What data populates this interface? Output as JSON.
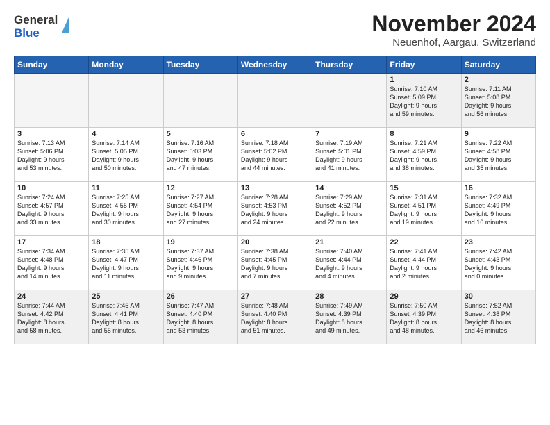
{
  "logo": {
    "line1": "General",
    "line2": "Blue"
  },
  "header": {
    "month": "November 2024",
    "location": "Neuenhof, Aargau, Switzerland"
  },
  "weekdays": [
    "Sunday",
    "Monday",
    "Tuesday",
    "Wednesday",
    "Thursday",
    "Friday",
    "Saturday"
  ],
  "weeks": [
    [
      {
        "day": "",
        "info": ""
      },
      {
        "day": "",
        "info": ""
      },
      {
        "day": "",
        "info": ""
      },
      {
        "day": "",
        "info": ""
      },
      {
        "day": "",
        "info": ""
      },
      {
        "day": "1",
        "info": "Sunrise: 7:10 AM\nSunset: 5:09 PM\nDaylight: 9 hours and 59 minutes."
      },
      {
        "day": "2",
        "info": "Sunrise: 7:11 AM\nSunset: 5:08 PM\nDaylight: 9 hours and 56 minutes."
      }
    ],
    [
      {
        "day": "3",
        "info": "Sunrise: 7:13 AM\nSunset: 5:06 PM\nDaylight: 9 hours and 53 minutes."
      },
      {
        "day": "4",
        "info": "Sunrise: 7:14 AM\nSunset: 5:05 PM\nDaylight: 9 hours and 50 minutes."
      },
      {
        "day": "5",
        "info": "Sunrise: 7:16 AM\nSunset: 5:03 PM\nDaylight: 9 hours and 47 minutes."
      },
      {
        "day": "6",
        "info": "Sunrise: 7:18 AM\nSunset: 5:02 PM\nDaylight: 9 hours and 44 minutes."
      },
      {
        "day": "7",
        "info": "Sunrise: 7:19 AM\nSunset: 5:01 PM\nDaylight: 9 hours and 41 minutes."
      },
      {
        "day": "8",
        "info": "Sunrise: 7:21 AM\nSunset: 4:59 PM\nDaylight: 9 hours and 38 minutes."
      },
      {
        "day": "9",
        "info": "Sunrise: 7:22 AM\nSunset: 4:58 PM\nDaylight: 9 hours and 35 minutes."
      }
    ],
    [
      {
        "day": "10",
        "info": "Sunrise: 7:24 AM\nSunset: 4:57 PM\nDaylight: 9 hours and 33 minutes."
      },
      {
        "day": "11",
        "info": "Sunrise: 7:25 AM\nSunset: 4:55 PM\nDaylight: 9 hours and 30 minutes."
      },
      {
        "day": "12",
        "info": "Sunrise: 7:27 AM\nSunset: 4:54 PM\nDaylight: 9 hours and 27 minutes."
      },
      {
        "day": "13",
        "info": "Sunrise: 7:28 AM\nSunset: 4:53 PM\nDaylight: 9 hours and 24 minutes."
      },
      {
        "day": "14",
        "info": "Sunrise: 7:29 AM\nSunset: 4:52 PM\nDaylight: 9 hours and 22 minutes."
      },
      {
        "day": "15",
        "info": "Sunrise: 7:31 AM\nSunset: 4:51 PM\nDaylight: 9 hours and 19 minutes."
      },
      {
        "day": "16",
        "info": "Sunrise: 7:32 AM\nSunset: 4:49 PM\nDaylight: 9 hours and 16 minutes."
      }
    ],
    [
      {
        "day": "17",
        "info": "Sunrise: 7:34 AM\nSunset: 4:48 PM\nDaylight: 9 hours and 14 minutes."
      },
      {
        "day": "18",
        "info": "Sunrise: 7:35 AM\nSunset: 4:47 PM\nDaylight: 9 hours and 11 minutes."
      },
      {
        "day": "19",
        "info": "Sunrise: 7:37 AM\nSunset: 4:46 PM\nDaylight: 9 hours and 9 minutes."
      },
      {
        "day": "20",
        "info": "Sunrise: 7:38 AM\nSunset: 4:45 PM\nDaylight: 9 hours and 7 minutes."
      },
      {
        "day": "21",
        "info": "Sunrise: 7:40 AM\nSunset: 4:44 PM\nDaylight: 9 hours and 4 minutes."
      },
      {
        "day": "22",
        "info": "Sunrise: 7:41 AM\nSunset: 4:44 PM\nDaylight: 9 hours and 2 minutes."
      },
      {
        "day": "23",
        "info": "Sunrise: 7:42 AM\nSunset: 4:43 PM\nDaylight: 9 hours and 0 minutes."
      }
    ],
    [
      {
        "day": "24",
        "info": "Sunrise: 7:44 AM\nSunset: 4:42 PM\nDaylight: 8 hours and 58 minutes."
      },
      {
        "day": "25",
        "info": "Sunrise: 7:45 AM\nSunset: 4:41 PM\nDaylight: 8 hours and 55 minutes."
      },
      {
        "day": "26",
        "info": "Sunrise: 7:47 AM\nSunset: 4:40 PM\nDaylight: 8 hours and 53 minutes."
      },
      {
        "day": "27",
        "info": "Sunrise: 7:48 AM\nSunset: 4:40 PM\nDaylight: 8 hours and 51 minutes."
      },
      {
        "day": "28",
        "info": "Sunrise: 7:49 AM\nSunset: 4:39 PM\nDaylight: 8 hours and 49 minutes."
      },
      {
        "day": "29",
        "info": "Sunrise: 7:50 AM\nSunset: 4:39 PM\nDaylight: 8 hours and 48 minutes."
      },
      {
        "day": "30",
        "info": "Sunrise: 7:52 AM\nSunset: 4:38 PM\nDaylight: 8 hours and 46 minutes."
      }
    ]
  ]
}
